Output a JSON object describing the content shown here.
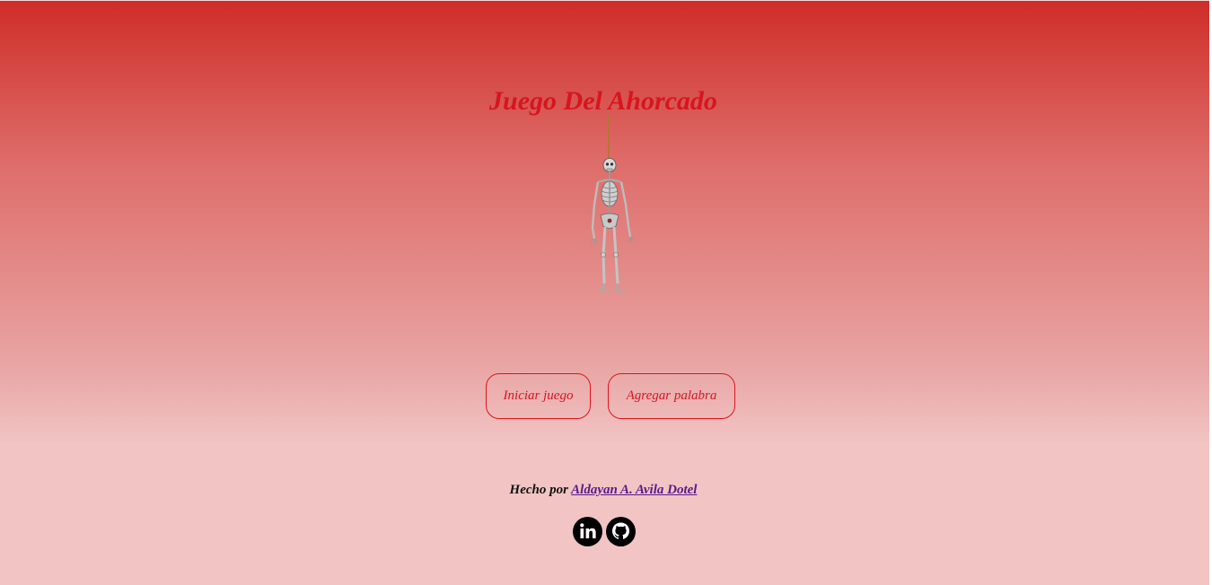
{
  "page": {
    "title": "Juego Del Ahorcado"
  },
  "actions": {
    "start_label": "Iniciar juego",
    "add_word_label": "Agregar palabra"
  },
  "footer": {
    "made_by": "Hecho por",
    "author": "Aldayan A. Avila Dotel"
  },
  "social": [
    {
      "icon": "linkedin-icon"
    },
    {
      "icon": "github-icon"
    }
  ],
  "colors": {
    "accent": "#d5161f",
    "background_top": "#cf2d28",
    "background_bottom": "#f2c4c4",
    "link": "#5b1a8a"
  }
}
